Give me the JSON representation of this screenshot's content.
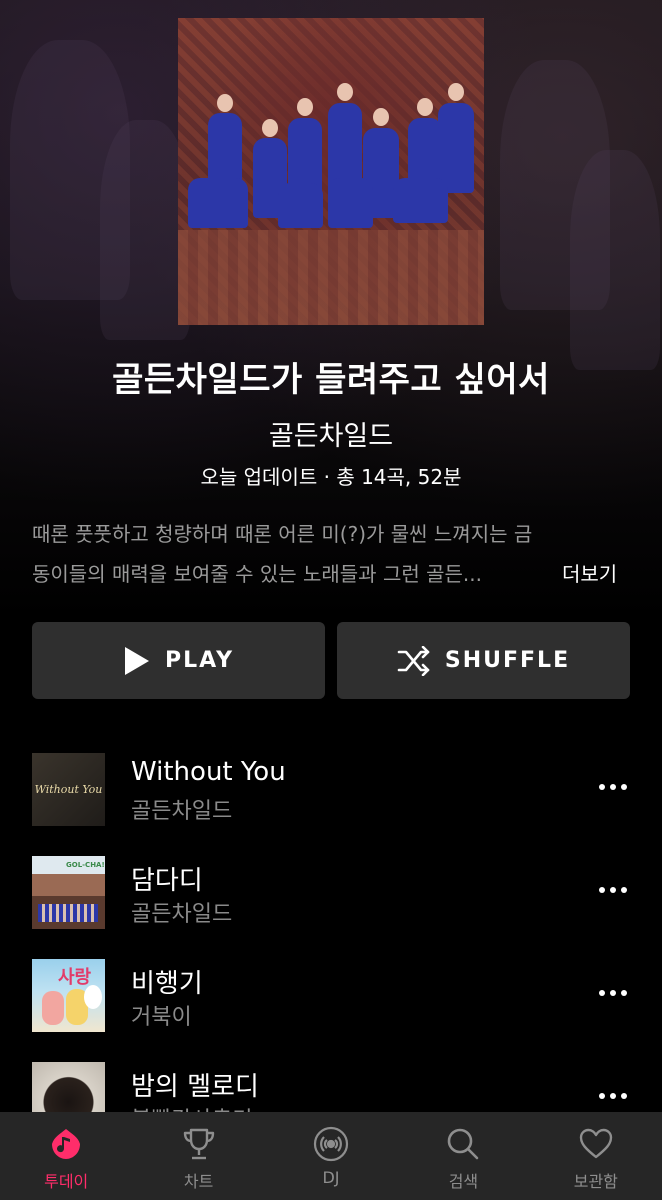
{
  "playlist": {
    "title": "골든차일드가 들려주고 싶어서",
    "artist": "골든차일드",
    "meta": "오늘 업데이트 · 총 14곡, 52분",
    "description_line1": "때론 풋풋하고 청량하며 때론 어른 미(?)가 물씬 느껴지는 금",
    "description_line2": "동이들의 매력을 보여줄 수 있는 노래들과 그런 골든...",
    "more_label": "더보기"
  },
  "actions": {
    "play_label": "PLAY",
    "shuffle_label": "SHUFFLE"
  },
  "tracks": [
    {
      "title": "Without You",
      "artist": "골든차일드",
      "thumb_text": "Without You"
    },
    {
      "title": "담다디",
      "artist": "골든차일드",
      "thumb_text": "GOL-CHA!"
    },
    {
      "title": "비행기",
      "artist": "거북이",
      "thumb_text": "사랑"
    },
    {
      "title": "밤의 멜로디",
      "artist": "볼빨간사춘기",
      "thumb_text": ""
    }
  ],
  "nav": {
    "items": [
      {
        "label": "투데이",
        "icon": "music-note-icon",
        "active": true
      },
      {
        "label": "차트",
        "icon": "trophy-icon"
      },
      {
        "label": "DJ",
        "icon": "radio-icon"
      },
      {
        "label": "검색",
        "icon": "search-icon"
      },
      {
        "label": "보관함",
        "icon": "heart-icon"
      }
    ]
  },
  "colors": {
    "accent": "#ff2d6a",
    "button_bg": "#2f2f2f",
    "nav_bg": "#262626",
    "muted_text": "#8a8a8a"
  }
}
